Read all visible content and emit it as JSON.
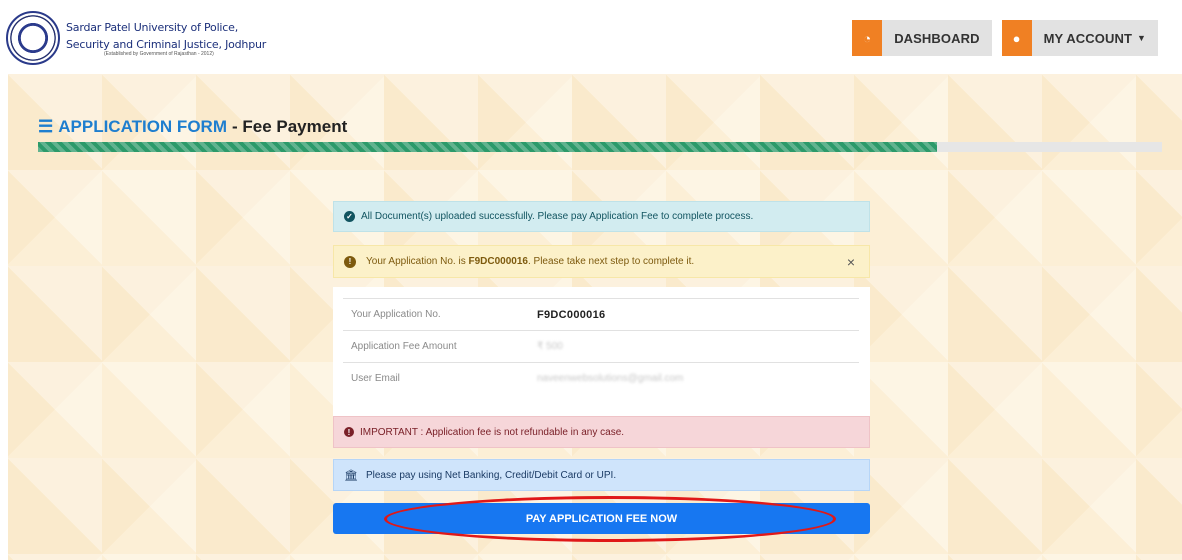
{
  "header": {
    "university_line1": "Sardar Patel University of Police,",
    "university_line2": "Security and Criminal Justice, Jodhpur",
    "university_line3": "(Established by Government of Rajasthan - 2012)",
    "nav": {
      "dashboard_label": "DASHBOARD",
      "my_account_label": "MY ACCOUNT"
    },
    "accent_color": "#f08023"
  },
  "page": {
    "title_main": "APPLICATION FORM",
    "title_sub": "- Fee Payment",
    "progress_percent": 80
  },
  "alerts": {
    "success": "All Document(s) uploaded successfully. Please pay Application Fee to complete process.",
    "warning_prefix": "Your Application No. is ",
    "warning_app_no": "F9DC000016",
    "warning_suffix": ". Please take next step to complete it.",
    "warning_close": "×",
    "important": "IMPORTANT : Application fee is not refundable in any case.",
    "payment_info": "Please pay using Net Banking, Credit/Debit Card or UPI."
  },
  "details": [
    {
      "label": "Your Application No.",
      "value": "F9DC000016"
    },
    {
      "label": "Application Fee Amount",
      "value": "₹ 500"
    },
    {
      "label": "User Email",
      "value": "naveenwebsolutions@gmail.com"
    }
  ],
  "pay_button_label": "PAY APPLICATION FEE NOW"
}
